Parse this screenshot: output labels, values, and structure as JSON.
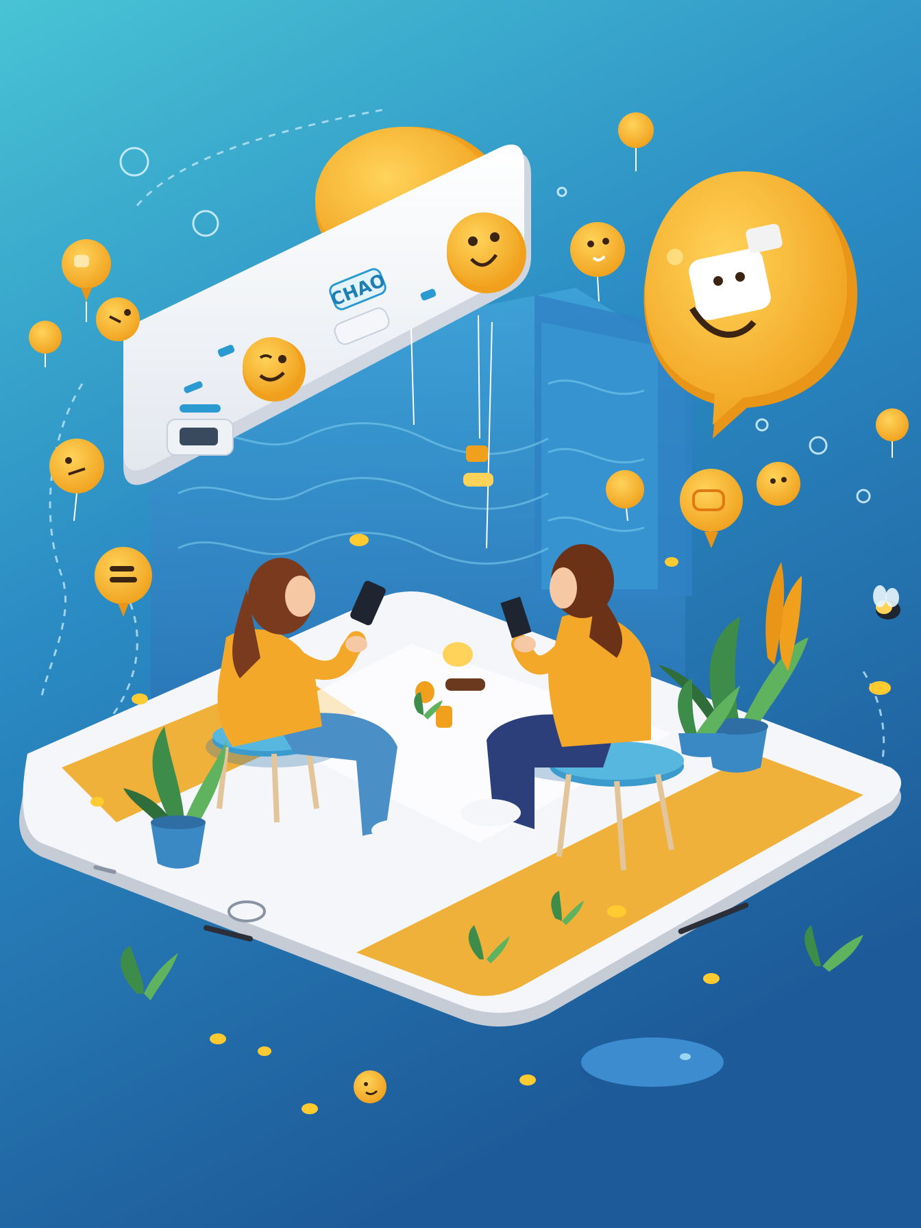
{
  "scene": {
    "background_top": "#45c1d3",
    "background_bottom": "#1f5f9f",
    "accent_yellow": "#f6b529",
    "accent_orange": "#ee9a17",
    "device_white": "#f4f6fa",
    "floor_orange": "#f0b13a"
  },
  "chat_panel": {
    "label": "CHAO"
  },
  "figures": {
    "shirt_color": "#f3a82a",
    "jeans_left": "#4a8fc6",
    "jeans_right": "#2c3f7a",
    "hair_color": "#7a3a1e",
    "stool_color": "#57b7df"
  },
  "elements": {
    "bubbles": "emoji-speech-bubbles",
    "plants": "potted-plants",
    "coins": "gold-coins",
    "bee": "bee-icon"
  }
}
